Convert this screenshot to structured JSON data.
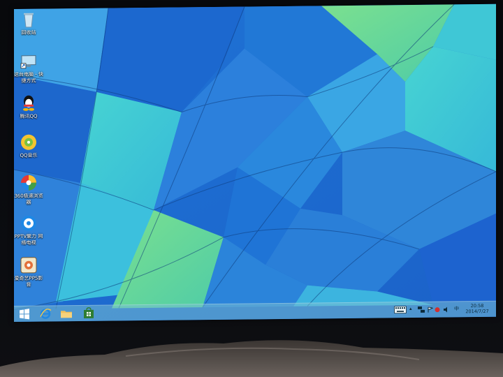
{
  "desktop": {
    "icons": [
      {
        "name": "recycle-bin-icon",
        "label": "回收站"
      },
      {
        "name": "this-pc-shortcut-icon",
        "label": "这台电脑 - 快捷方式"
      },
      {
        "name": "tencent-qq-icon",
        "label": "腾讯QQ"
      },
      {
        "name": "qq-music-icon",
        "label": "QQ音乐"
      },
      {
        "name": "browser-360-icon",
        "label": "360极速浏览器"
      },
      {
        "name": "pptv-icon",
        "label": "PPTV聚力 网络电视"
      },
      {
        "name": "app-shortcut-icon",
        "label": "爱奇艺PPS影音"
      }
    ]
  },
  "taskbar": {
    "buttons": [
      {
        "name": "start-button-icon"
      },
      {
        "name": "internet-explorer-icon"
      },
      {
        "name": "file-explorer-icon"
      },
      {
        "name": "store-icon"
      }
    ],
    "tray": {
      "keyboard_icon": "keyboard-icon",
      "ime": "中",
      "time": "20:58",
      "date": "2014/7/27"
    }
  },
  "colors": {
    "wallpaper_blue": "#1f74d6",
    "wallpaper_light": "#48c6e6",
    "wallpaper_teal": "#43d6c4",
    "wallpaper_green": "#63d79a",
    "taskbar": "#7fc1d2"
  }
}
